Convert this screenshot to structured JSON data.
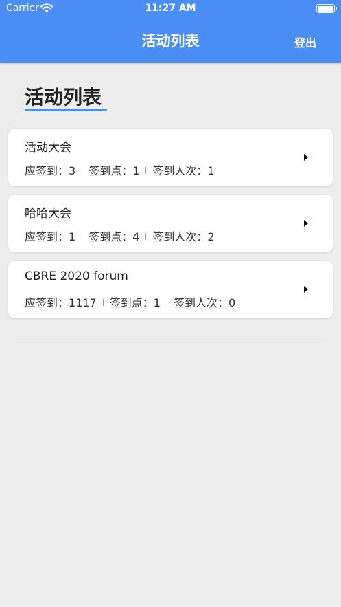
{
  "status_bar": {
    "carrier": "Carrier",
    "time": "11:27 AM"
  },
  "nav": {
    "title": "活动列表",
    "logout_label": "登出"
  },
  "page": {
    "heading": "活动列表"
  },
  "colors": {
    "accent": "#4a8ef5",
    "background": "#ededed"
  },
  "events": [
    {
      "name": "活动大会",
      "stats": [
        {
          "label": "应签到：",
          "value": "3"
        },
        {
          "label": "签到点：",
          "value": "1"
        },
        {
          "label": "签到人次：",
          "value": "1"
        }
      ]
    },
    {
      "name": "哈哈大会",
      "stats": [
        {
          "label": "应签到：",
          "value": "1"
        },
        {
          "label": "签到点：",
          "value": "4"
        },
        {
          "label": "签到人次：",
          "value": "2"
        }
      ]
    },
    {
      "name": "CBRE 2020 forum",
      "stats": [
        {
          "label": "应签到：",
          "value": "1117"
        },
        {
          "label": "签到点：",
          "value": "1"
        },
        {
          "label": "签到人次：",
          "value": "0"
        }
      ]
    }
  ]
}
